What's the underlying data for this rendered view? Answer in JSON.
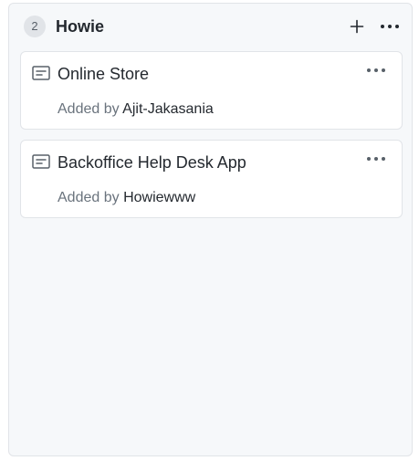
{
  "column": {
    "count": "2",
    "title": "Howie",
    "add_icon": "plus-icon",
    "menu_icon": "kebab-horizontal-icon"
  },
  "cards": [
    {
      "icon": "note-icon",
      "title": "Online Store",
      "added_prefix": "Added by",
      "added_user": "Ajit-Jakasania",
      "menu_icon": "kebab-horizontal-icon"
    },
    {
      "icon": "note-icon",
      "title": "Backoffice Help Desk App",
      "added_prefix": "Added by",
      "added_user": "Howiewww",
      "menu_icon": "kebab-horizontal-icon"
    }
  ],
  "colors": {
    "column_bg": "#f6f8fa",
    "border": "#e1e4e8",
    "text": "#24292f",
    "muted": "#6a737d"
  }
}
